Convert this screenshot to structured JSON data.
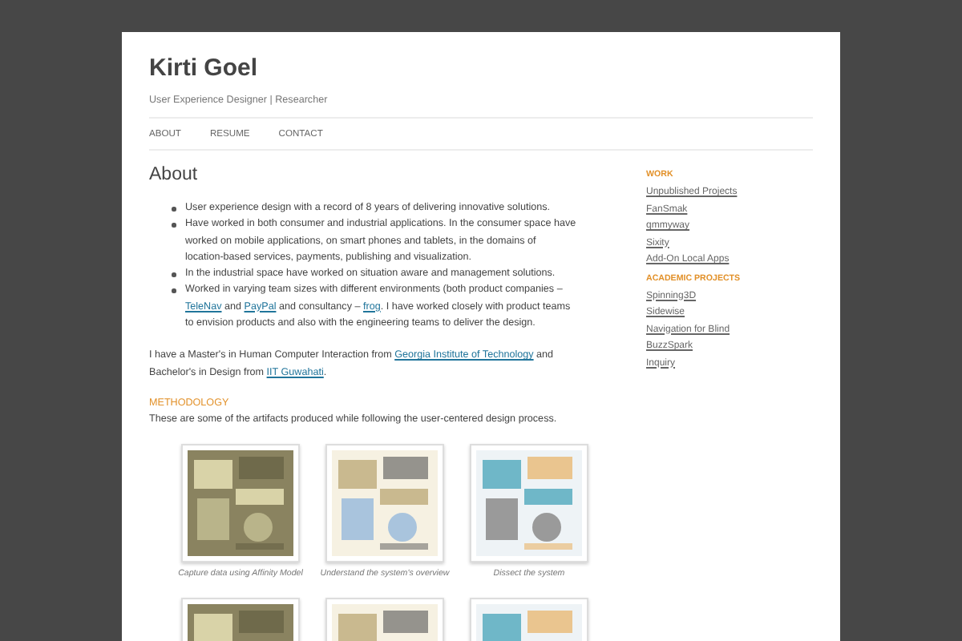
{
  "site": {
    "title": "Kirti Goel",
    "tagline": "User Experience Designer | Researcher"
  },
  "nav": [
    {
      "label": "ABOUT"
    },
    {
      "label": "RESUME"
    },
    {
      "label": "CONTACT"
    }
  ],
  "page": {
    "heading": "About",
    "bullets": [
      {
        "parts": [
          {
            "text": "User experience design with a record of 8 years of delivering innovative solutions."
          }
        ]
      },
      {
        "parts": [
          {
            "text": "Have worked in both consumer and industrial applications. In the consumer space have worked on mobile applications, on smart phones and tablets, in the domains of location-based services, payments, publishing and visualization."
          }
        ]
      },
      {
        "parts": [
          {
            "text": "In the industrial space have worked on situation aware and management solutions."
          }
        ]
      },
      {
        "parts": [
          {
            "text": "Worked in varying team sizes with different environments (both product companies – "
          },
          {
            "text": "TeleNav",
            "link": true
          },
          {
            "text": " and "
          },
          {
            "text": "PayPal",
            "link": true
          },
          {
            "text": " and consultancy – "
          },
          {
            "text": "frog",
            "link": true
          },
          {
            "text": ". I have worked closely with product teams to envision products and also with the engineering teams to deliver the design."
          }
        ]
      }
    ],
    "education": [
      {
        "text": "I have a Master's in Human Computer Interaction from "
      },
      {
        "text": "Georgia Institute of Technology",
        "link": true
      },
      {
        "text": " and Bachelor's in Design from "
      },
      {
        "text": "IIT Guwahati",
        "link": true
      },
      {
        "text": "."
      }
    ],
    "section_heading": "METHODOLOGY",
    "section_intro": "These are some of the artifacts produced while following the user-centered design process.",
    "gallery": [
      {
        "kind": "picture",
        "caption": "Capture data using Affinity Model"
      },
      {
        "kind": "picture",
        "caption": "Understand the system's overview"
      },
      {
        "kind": "picture",
        "caption": "Dissect the system"
      },
      {
        "kind": "picture"
      },
      {
        "kind": "picture"
      },
      {
        "kind": "picture"
      }
    ]
  },
  "sidebar": [
    {
      "heading": "WORK",
      "links": [
        "Unpublished Projects",
        "FanSmak",
        "qmmyway",
        "Sixity",
        "Add-On Local Apps"
      ]
    },
    {
      "heading": "ACADEMIC PROJECTS",
      "links": [
        "Spinning3D",
        "Sidewise",
        "Navigation for Blind",
        "BuzzSpark",
        "Inquiry"
      ]
    }
  ]
}
